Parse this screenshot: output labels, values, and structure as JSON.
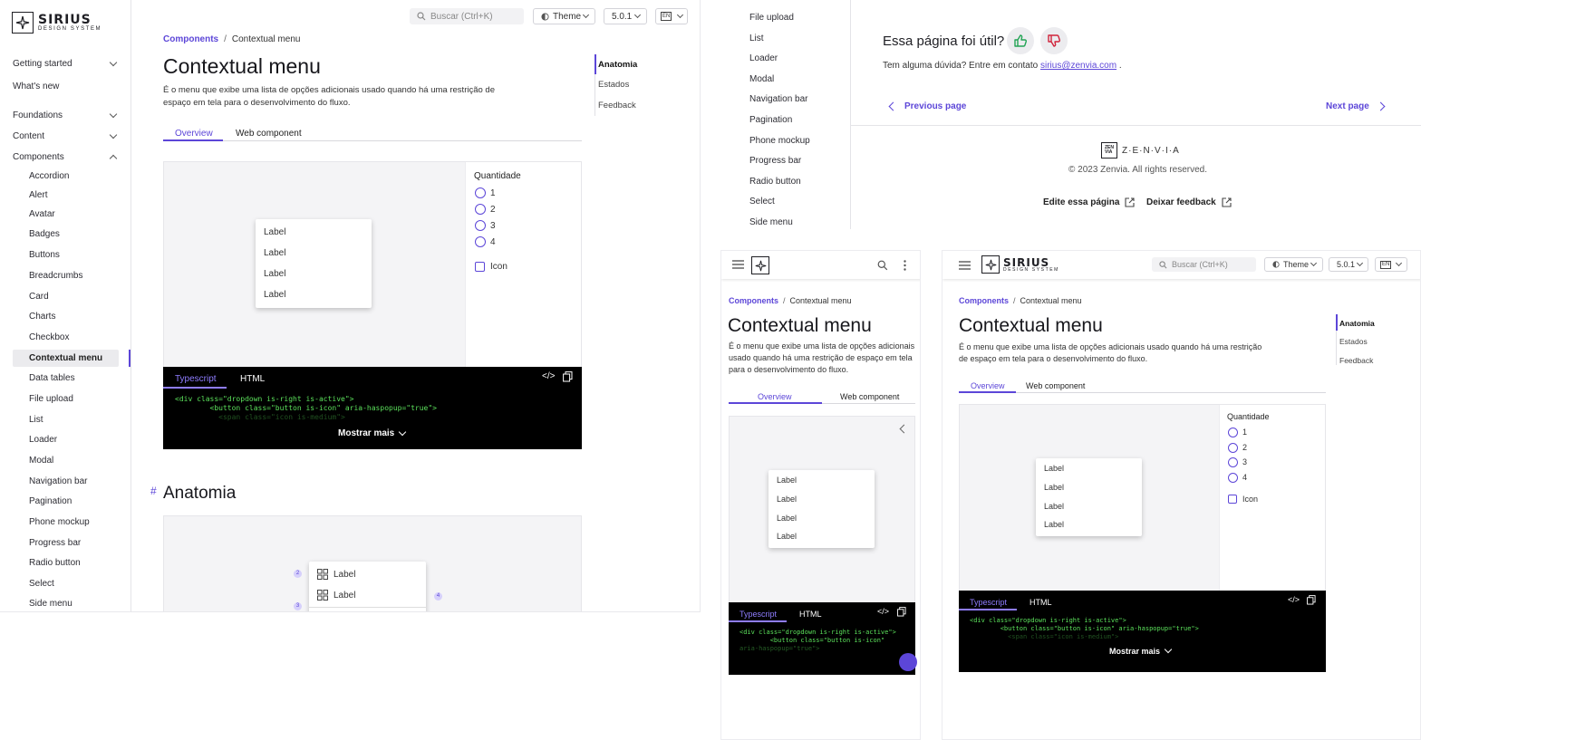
{
  "brand": {
    "name": "SIRIUS",
    "subtitle": "DESIGN SYSTEM"
  },
  "sidebar": {
    "groups": [
      {
        "label": "Getting started",
        "expanded": false
      },
      {
        "label": "What's new"
      },
      {
        "label": "Foundations",
        "expanded": false
      },
      {
        "label": "Content",
        "expanded": false
      },
      {
        "label": "Components",
        "expanded": true
      }
    ],
    "components": [
      "Accordion",
      "Alert",
      "Avatar",
      "Badges",
      "Buttons",
      "Breadcrumbs",
      "Card",
      "Charts",
      "Checkbox",
      "Contextual menu",
      "Data tables",
      "File upload",
      "List",
      "Loader",
      "Modal",
      "Navigation bar",
      "Pagination",
      "Phone mockup",
      "Progress bar",
      "Radio button",
      "Select",
      "Side menu"
    ],
    "active": "Contextual menu"
  },
  "topbar": {
    "search_placeholder": "Buscar (Ctrl+K)",
    "theme_label": "Theme",
    "version": "5.0.1",
    "lang": "EN"
  },
  "breadcrumb": {
    "parent": "Components",
    "separator": "/",
    "current": "Contextual menu"
  },
  "page": {
    "title": "Contextual menu",
    "description_line1": "É o menu que exibe uma lista de opções adicionais usado quando há uma restrição de",
    "description_line2": "espaço em tela para o desenvolvimento do fluxo.",
    "mobile_desc_line1": "É o menu que exibe uma lista de opções adicionais",
    "mobile_desc_line2": "usado quando há uma restrição de espaço em tela",
    "mobile_desc_line3": "para o desenvolvimento do fluxo.",
    "tablet_desc_line1": "É o menu que exibe uma lista de opções adicionais usado quando há uma restrição",
    "tablet_desc_line2": "de espaço em tela para o desenvolvimento do fluxo.",
    "tabs": [
      "Overview",
      "Web component"
    ],
    "section_anchor": "#",
    "section_title": "Anatomia"
  },
  "toc": [
    "Anatomia",
    "Estados",
    "Feedback"
  ],
  "demo": {
    "menu_items": [
      "Label",
      "Label",
      "Label",
      "Label"
    ],
    "control_title": "Quantidade",
    "radio_options": [
      "1",
      "2",
      "3",
      "4"
    ],
    "checkbox_label": "Icon"
  },
  "code": {
    "tabs": [
      "Typescript",
      "HTML"
    ],
    "line1": "<div class=\"dropdown is-right is-active\">",
    "line2": "        <button class=\"button is-icon\" aria-haspopup=\"true\">",
    "line3": "          <span class=\"icon is-medium\">",
    "mobile_line2": "        <button class=\"button is-icon\"",
    "mobile_line3": "aria-haspopup=\"true\">",
    "show_more": "Mostrar mais"
  },
  "anatomy": {
    "items": [
      "Label",
      "Label"
    ],
    "markers": [
      "2",
      "3",
      "4"
    ]
  },
  "footer": {
    "feedback_question": "Essa página foi útil?",
    "contact_text": "Tem alguma dúvida? Entre em contato",
    "contact_email": "sirius@zenvia.com",
    "contact_end": ".",
    "prev": "Previous page",
    "next": "Next page",
    "company": "Z·E·N·V·I·A",
    "copyright": "© 2023 Zenvia. All rights reserved.",
    "edit_page": "Edite essa página",
    "give_feedback": "Deixar feedback"
  },
  "colors": {
    "accent": "#5c46d8",
    "like": "#23a455",
    "dislike": "#d0243c",
    "code_bg": "#000000",
    "code_text": "#5be05b"
  }
}
